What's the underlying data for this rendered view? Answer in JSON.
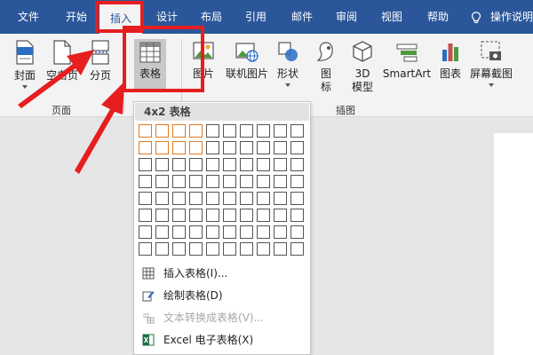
{
  "tabs": [
    {
      "label": "文件"
    },
    {
      "label": "开始"
    },
    {
      "label": "插入"
    },
    {
      "label": "设计"
    },
    {
      "label": "布局"
    },
    {
      "label": "引用"
    },
    {
      "label": "邮件"
    },
    {
      "label": "审阅"
    },
    {
      "label": "视图"
    },
    {
      "label": "帮助"
    }
  ],
  "active_tab": "插入",
  "tell_me": "操作说明",
  "ribbon": {
    "groups": {
      "pages": "页面",
      "illustrations": "插图"
    },
    "buttons": {
      "cover": "封面",
      "blank_page": "空白页",
      "page_break": "分页",
      "table": "表格",
      "pictures": "图片",
      "online_pictures": "联机图片",
      "shapes": "形状",
      "icons_1": "图",
      "icons_2": "标",
      "models_1": "3D",
      "models_2": "模型",
      "smartart": "SmartArt",
      "chart": "图表",
      "screenshot": "屏幕截图"
    }
  },
  "table_menu": {
    "header": "4x2 表格",
    "grid": {
      "columns": 10,
      "rows": 8,
      "highlight_columns": 4,
      "highlight_rows": 2
    },
    "items": [
      {
        "label": "插入表格(I)...",
        "icon": "table-grid-icon",
        "enabled": true
      },
      {
        "label": "绘制表格(D)",
        "icon": "pencil-table-icon",
        "enabled": true
      },
      {
        "label": "文本转换成表格(V)...",
        "icon": "text-to-table-icon",
        "enabled": false
      },
      {
        "label": "Excel 电子表格(X)",
        "icon": "excel-icon",
        "enabled": true
      }
    ]
  },
  "colors": {
    "tab_bar": "#2b579a",
    "ribbon": "#f3f3f3",
    "annotation_red": "#e61e1e",
    "grid_highlight": "#e07b24"
  }
}
